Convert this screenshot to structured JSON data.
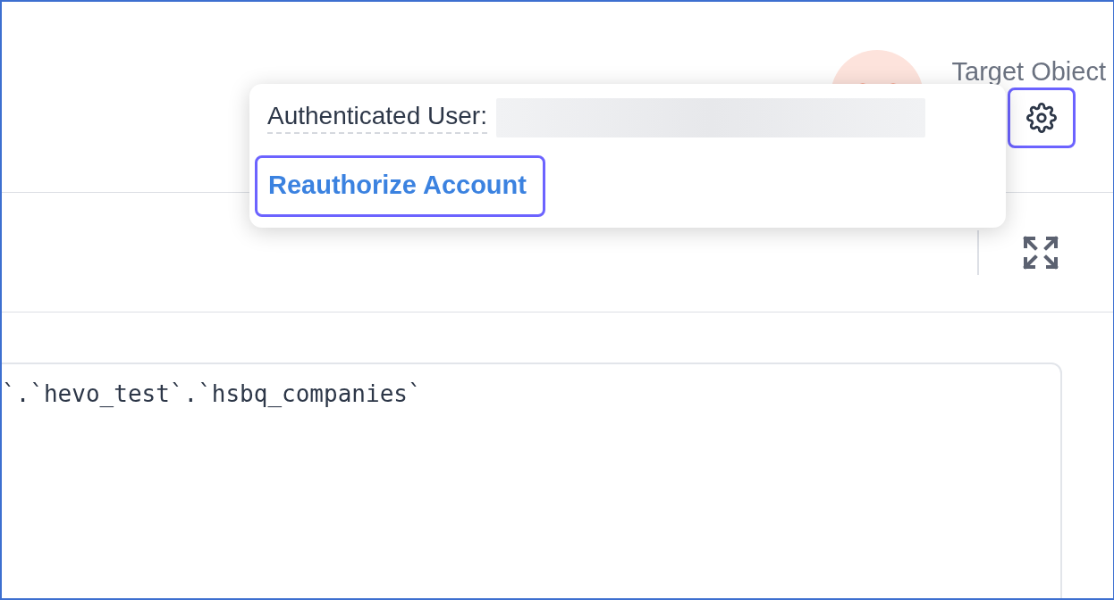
{
  "header": {
    "title": "Target Obiect"
  },
  "popover": {
    "label": "Authenticated User:",
    "action": "Reauthorize Account"
  },
  "editor": {
    "code": "`.`hevo_test`.`hsbq_companies`"
  }
}
